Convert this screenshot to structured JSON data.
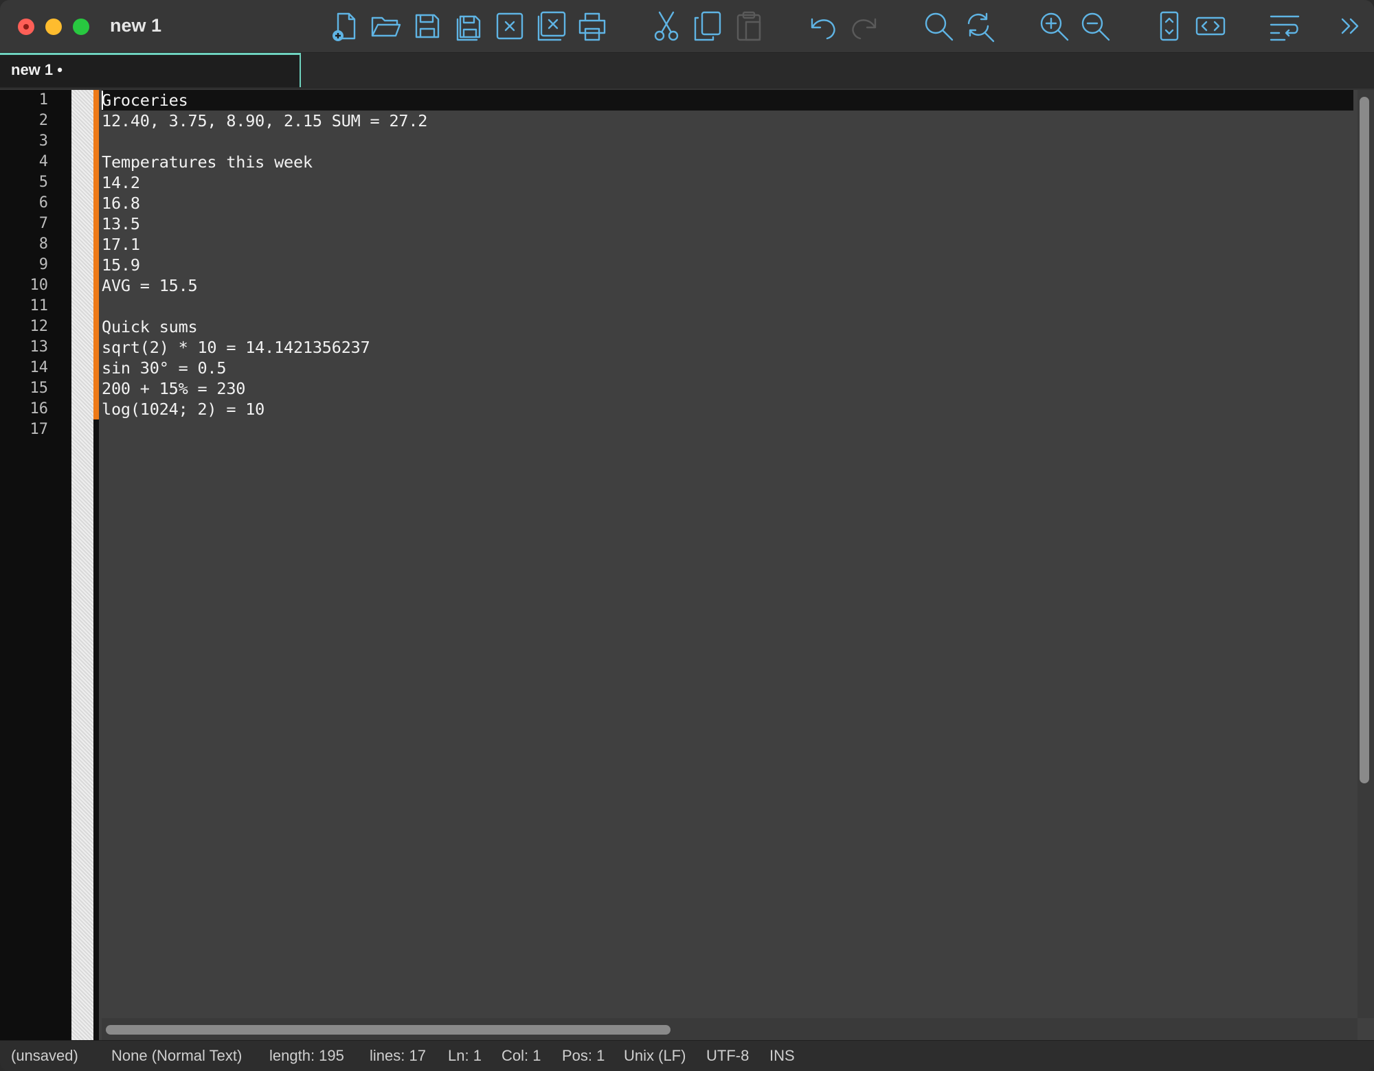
{
  "window": {
    "title": "new 1"
  },
  "toolbar": {
    "icons": [
      "new-file-icon",
      "open-file-icon",
      "save-icon",
      "save-all-icon",
      "close-file-icon",
      "close-all-icon",
      "print-icon",
      "cut-icon",
      "copy-icon",
      "paste-icon",
      "undo-icon",
      "redo-icon",
      "find-icon",
      "replace-icon",
      "zoom-in-icon",
      "zoom-out-icon",
      "sync-scroll-icon",
      "code-view-icon",
      "word-wrap-icon",
      "more-icon"
    ]
  },
  "tabs": [
    {
      "label": "new 1 •",
      "active": true
    }
  ],
  "editor": {
    "line_numbers": [
      "1",
      "2",
      "3",
      "4",
      "5",
      "6",
      "7",
      "8",
      "9",
      "10",
      "11",
      "12",
      "13",
      "14",
      "15",
      "16",
      "17"
    ],
    "lines": [
      "Groceries",
      "12.40, 3.75, 8.90, 2.15 SUM = 27.2",
      "",
      "Temperatures this week",
      "14.2",
      "16.8",
      "13.5",
      "17.1",
      "15.9",
      "AVG = 15.5",
      "",
      "Quick sums",
      "sqrt(2) * 10 = 14.1421356237",
      "sin 30° = 0.5",
      "200 + 15% = 230",
      "log(1024; 2) = 10",
      ""
    ],
    "current_line": 1
  },
  "status": {
    "file_state": "(unsaved)",
    "language": "None (Normal Text)",
    "length": "length: 195",
    "lines": "lines: 17",
    "ln": "Ln: 1",
    "col": "Col: 1",
    "pos": "Pos: 1",
    "eol": "Unix (LF)",
    "encoding": "UTF-8",
    "mode": "INS"
  },
  "colors": {
    "accent": "#5fb4e4",
    "tab_underline": "#6fd3bf",
    "change_bar": "#ee7a18",
    "editor_bg": "#404040",
    "gutter_bg": "#0e0e0e"
  }
}
